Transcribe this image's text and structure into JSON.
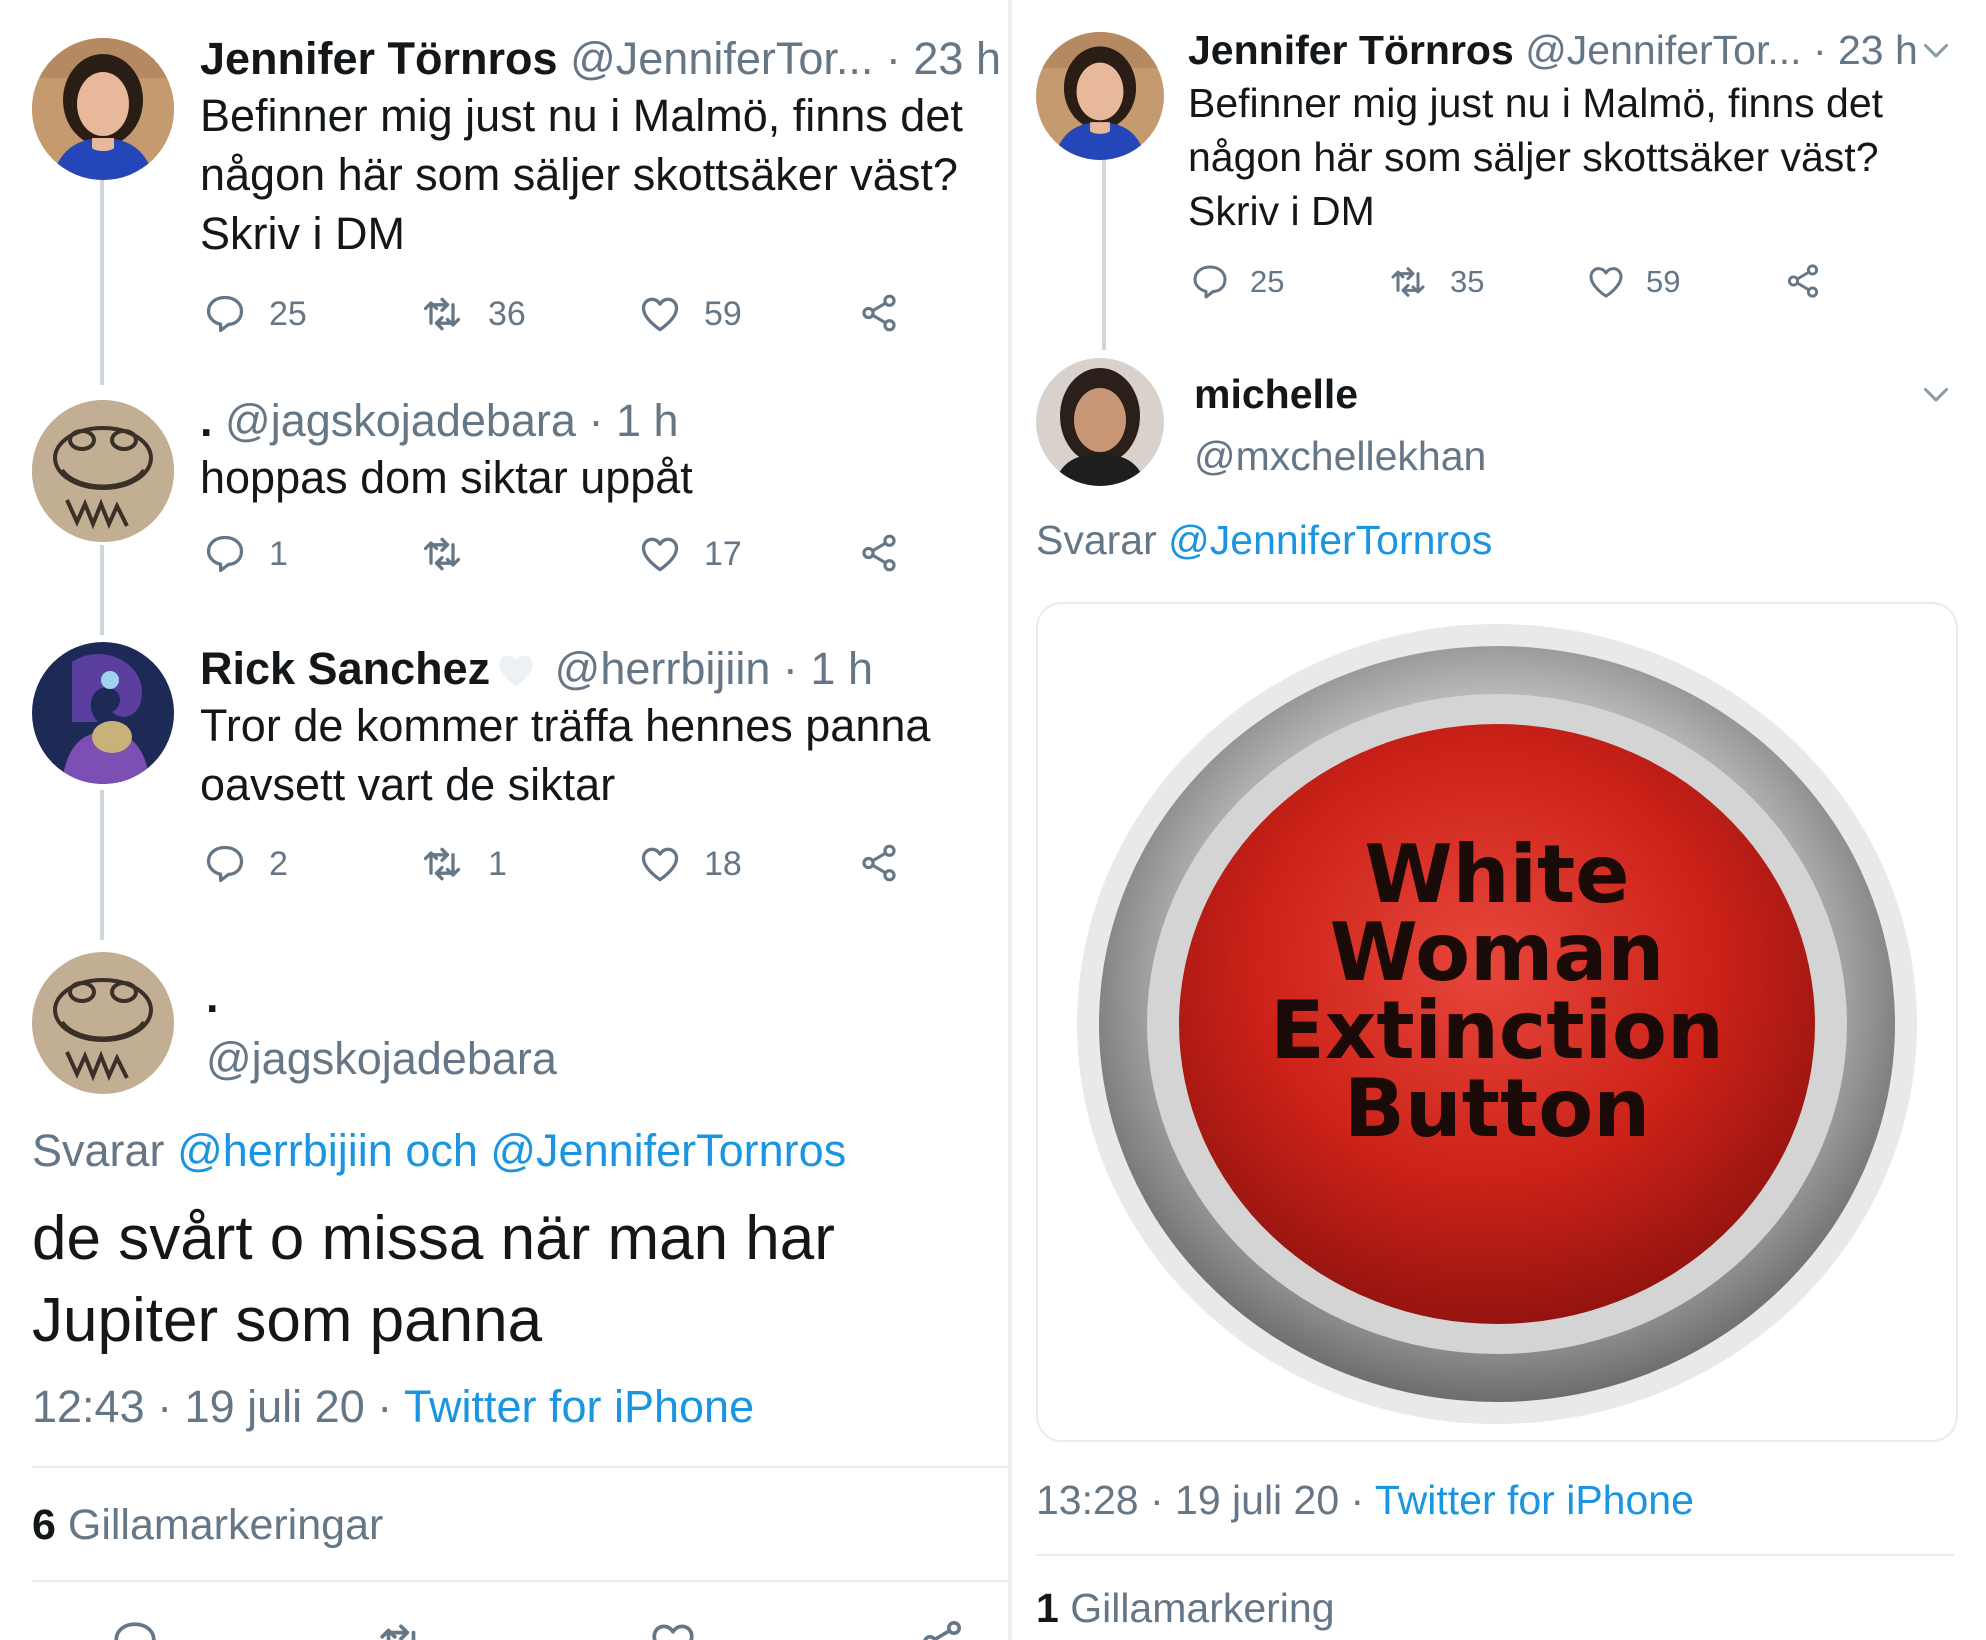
{
  "left": {
    "tweets": [
      {
        "name": "Jennifer Törnros",
        "handle": "@JenniferTor...",
        "time": "· 23 h",
        "text": [
          "Befinner mig just nu i Malmö, finns det",
          "någon här som säljer skottsäker väst?",
          "Skriv i DM"
        ],
        "replies": "25",
        "retweets": "36",
        "likes": "59"
      },
      {
        "name": ".",
        "handle": "@jagskojadebara",
        "time": "· 1 h",
        "text": [
          "hoppas dom siktar uppåt"
        ],
        "replies": "1",
        "retweets": "",
        "likes": "17"
      },
      {
        "name": "Rick Sanchez",
        "handle": "@herrbijiin",
        "time": "· 1 h",
        "text": [
          "Tror de kommer träffa hennes panna",
          "oavsett vart de siktar"
        ],
        "replies": "2",
        "retweets": "1",
        "likes": "18"
      }
    ],
    "focus": {
      "name": ".",
      "handle": "@jagskojadebara",
      "reply_prefix": "Svarar",
      "reply_to": "@herrbijiin och @JenniferTornros",
      "text": [
        "de svårt o missa när man har",
        "Jupiter som panna"
      ],
      "timestamp": "12:43 · 19 juli 20 ·",
      "source": "Twitter for iPhone",
      "likes_count": "6",
      "likes_label": "Gillamarkeringar"
    }
  },
  "right": {
    "tweet": {
      "name": "Jennifer Törnros",
      "handle": "@JenniferTor...",
      "time": "· 23 h",
      "text": [
        "Befinner mig just nu i Malmö, finns det",
        "någon här som säljer skottsäker väst?",
        "Skriv i DM"
      ],
      "replies": "25",
      "retweets": "35",
      "likes": "59"
    },
    "focus": {
      "name": "michelle",
      "handle": "@mxchellekhan",
      "reply_prefix": "Svarar",
      "reply_to": "@JenniferTornros",
      "image_text": [
        "White",
        "Woman",
        "Extinction",
        "Button"
      ],
      "timestamp": "13:28 · 19 juli 20 ·",
      "source": "Twitter for iPhone",
      "likes_count": "1",
      "likes_label": "Gillamarkering"
    }
  },
  "icons": [
    "reply-icon",
    "retweet-icon",
    "like-icon",
    "share-icon",
    "chevron-down-icon"
  ],
  "colors": {
    "link": "#1b95e0",
    "muted": "#657786",
    "text": "#14171a",
    "button_red": "#d42a22"
  }
}
